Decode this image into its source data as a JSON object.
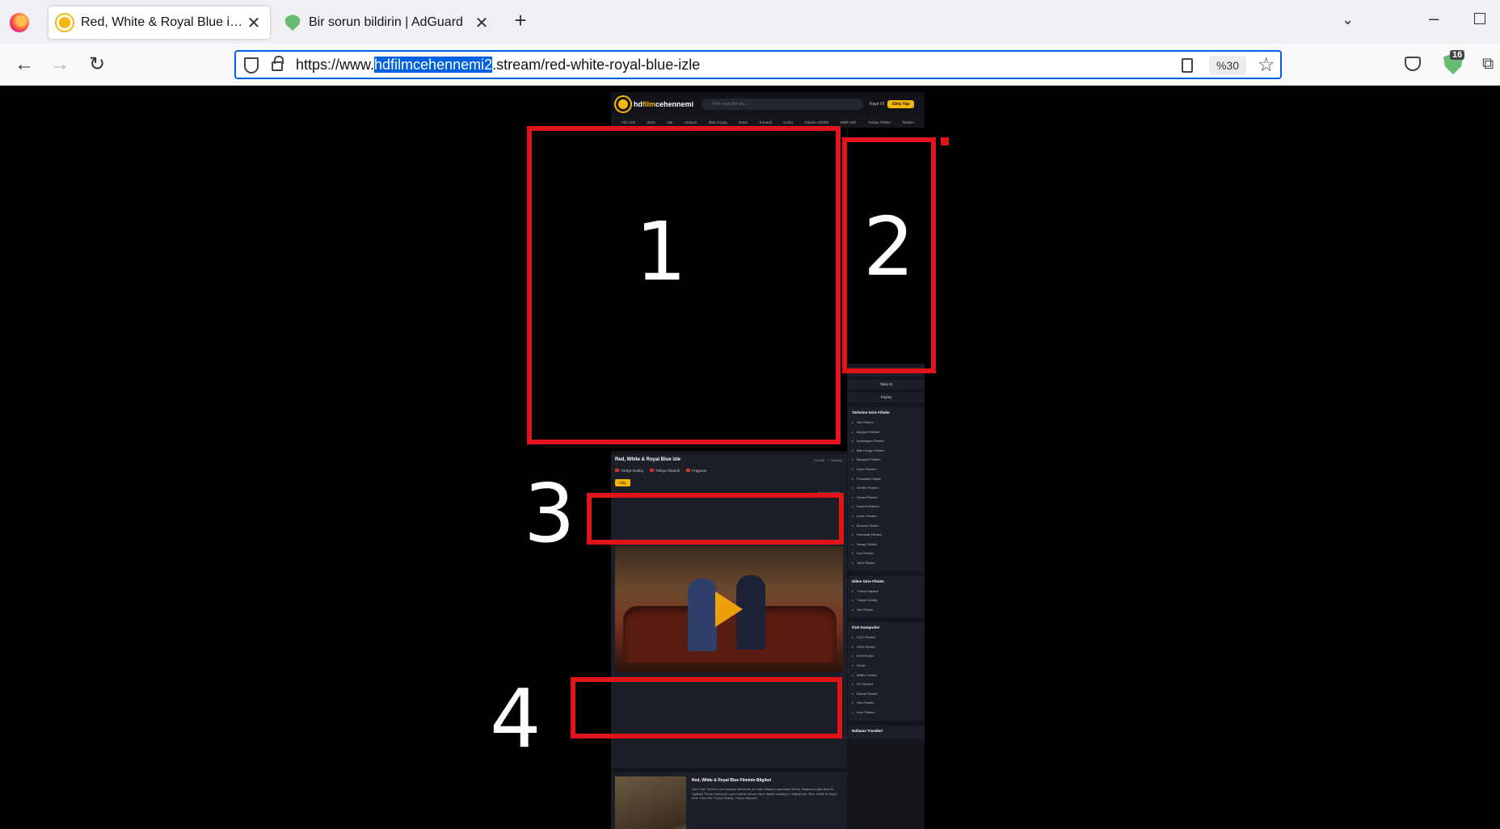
{
  "browser": {
    "tabs": [
      {
        "title": "Red, White & Royal Blue izle | H",
        "active": true
      },
      {
        "title": "Bir sorun bildirin | AdGuard",
        "active": false
      }
    ],
    "url_prefix": "https://www.",
    "url_highlight": "hdfilmcehennemi2",
    "url_suffix": ".stream/red-white-royal-blue-izle",
    "zoom": "%30",
    "adguard_count": "16"
  },
  "site": {
    "logo_hd": "hd",
    "logo_film": "film",
    "logo_rest": "cehennemi",
    "search_placeholder": "Film veya dizi ara…",
    "register": "Kayıt Ol",
    "login": "Giriş Yap",
    "menu": [
      "Film İzle",
      "2023",
      "Aile",
      "Aksiyon",
      "Bilim Kurgu",
      "Dram",
      "Komedi",
      "Korku",
      "Yabancı Diziler",
      "IMDb 250",
      "Türkçe Filmler",
      "İletişim"
    ],
    "player": {
      "title": "Red, White & Royal Blue izle",
      "meta": "Dizi tipi · ✓ Sorunlu",
      "langs": [
        "Türkçe Dublaj",
        "Türkçe Altyazılı",
        "Fragman"
      ],
      "source": "Vidy",
      "cinema_mode": "Sinema Modu"
    },
    "info": {
      "title": "Red, White & Royal Blue Filminin Bilgileri",
      "text": "New York Times'ın çok satanlar listesinde yer alan kitaptan uyarlanan filmde, Başkanın oğlu Alex ile İngiltere Prensi Henry'nin uzun süredir devam eden ilişkisi anlatılıyor. Orijinal Adı: Red, White & Royal Blue. Film Dili: Türkçe Dublaj, Türkçe Altyazılı."
    },
    "sidebar": {
      "buttons": [
        "İzledim olarak işaretle",
        "Takip Et",
        "Paylaş"
      ],
      "genres_title": "Türlerine Göre Filmler",
      "genres": [
        "Aile Filmleri",
        "Aksiyon Filmleri",
        "Animasyon Filmleri",
        "Bilim Kurgu Filmleri",
        "Biyografi Filmleri",
        "Dram Filmleri",
        "Fantastik Filmleri",
        "Gerilim Filmleri",
        "Gizem Filmleri",
        "Komedi Filmleri",
        "Korku Filmleri",
        "Macera Filmleri",
        "Romantik Filmleri",
        "Savaş Filmleri",
        "Suç Filmleri",
        "Tarih Filmleri"
      ],
      "lang_title": "Diline Göre Filmler",
      "langs": [
        "Türkçe Altyazılı",
        "Türkçe Dublaj",
        "Yerli Filmler"
      ],
      "special_title": "Özel Kategoriler",
      "special": [
        "2022 Filmleri",
        "2023 Filmleri",
        "Esri Filmleri",
        "Diziler",
        "Netflix Filmleri",
        "DC Filmleri",
        "Marvel Filmleri",
        "Hbo Filmleri",
        "Kore Filmleri"
      ],
      "trends_title": "Haftanın Trendleri"
    }
  },
  "annotations": [
    "1",
    "2",
    "3",
    "4"
  ],
  "colors": {
    "annotation_red": "#e0151b",
    "accent_yellow": "#f5b80a",
    "url_highlight_blue": "#0061e0"
  }
}
